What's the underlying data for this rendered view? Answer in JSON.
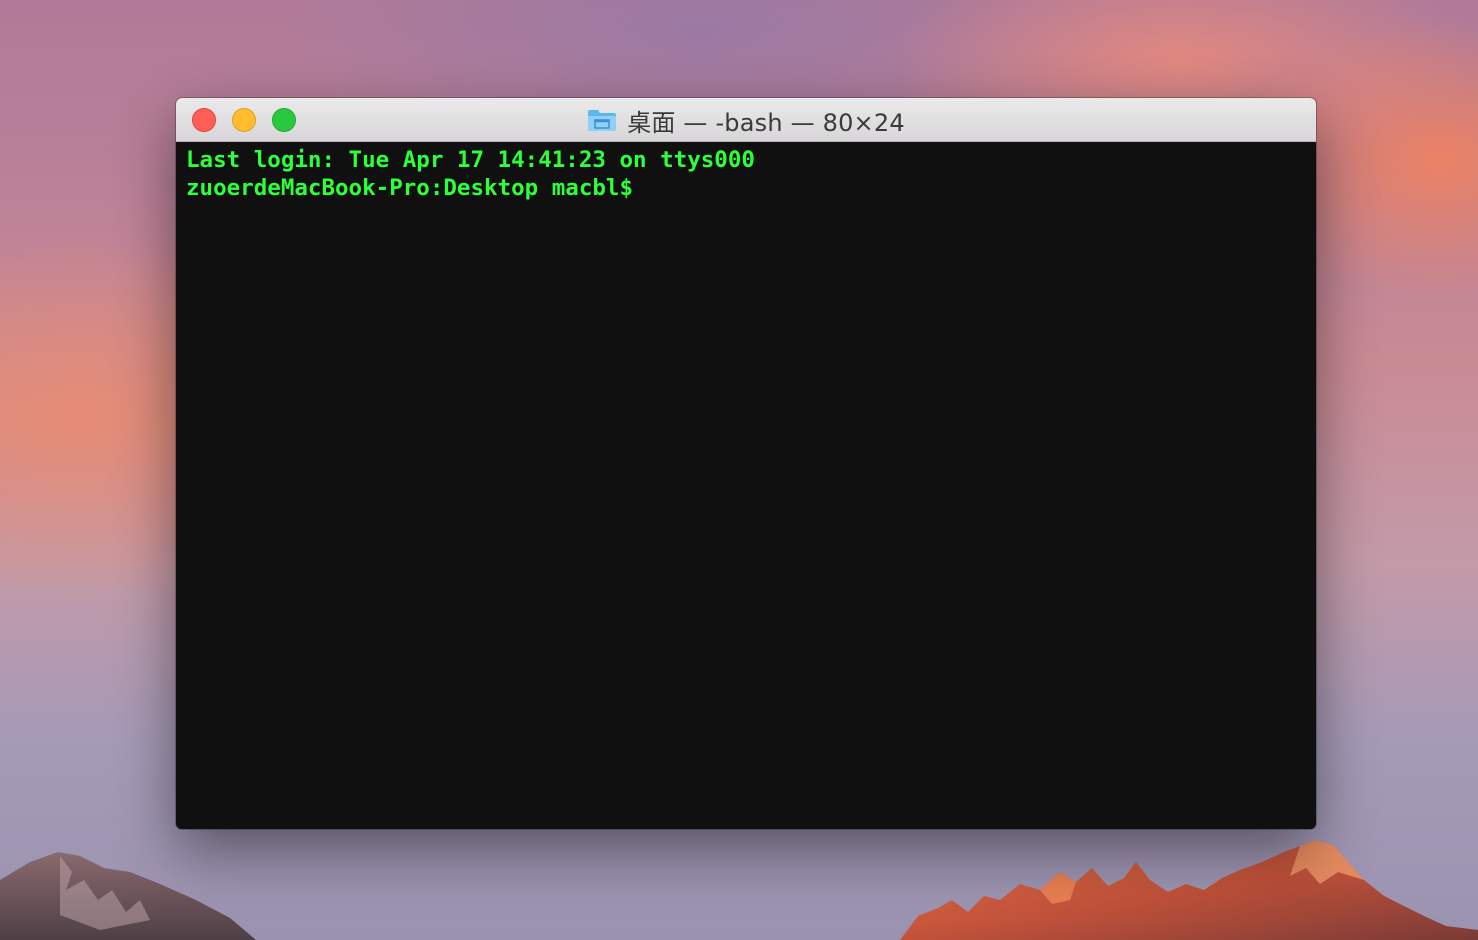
{
  "window": {
    "title_icon": "folder-icon",
    "title": "桌面 — -bash — 80×24",
    "controls": {
      "close": "close",
      "minimize": "minimize",
      "zoom": "zoom"
    }
  },
  "terminal": {
    "lines": [
      "Last login: Tue Apr 17 14:41:23 on ttys000",
      "zuoerdeMacBook-Pro:Desktop macbl$"
    ],
    "text_color": "#2dff3a",
    "background_color": "#111010"
  },
  "colors": {
    "close": "#fd5f57",
    "minimize": "#febc2e",
    "zoom": "#28c840"
  }
}
